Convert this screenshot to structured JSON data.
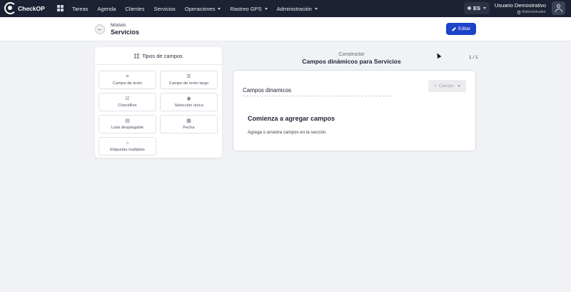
{
  "app": {
    "brand": "CheckOP"
  },
  "nav": {
    "items": [
      {
        "label": "Tareas",
        "dropdown": false
      },
      {
        "label": "Agenda",
        "dropdown": false
      },
      {
        "label": "Clientes",
        "dropdown": false
      },
      {
        "label": "Servicios",
        "dropdown": false
      },
      {
        "label": "Operaciones",
        "dropdown": true
      },
      {
        "label": "Rastreo GPS",
        "dropdown": true
      },
      {
        "label": "Administración",
        "dropdown": true
      }
    ],
    "language": "ES",
    "user": {
      "name": "Usuario Demostrativo",
      "role": "Administrador"
    }
  },
  "header": {
    "breadcrumb_small": "Módulo",
    "title": "Servicios",
    "edit_label": "Editar"
  },
  "field_types": {
    "title": "Tipos de campos",
    "items": [
      {
        "label": "Campo de texto",
        "icon": "text-lines-icon"
      },
      {
        "label": "Campo de texto largo",
        "icon": "long-text-icon"
      },
      {
        "label": "CheckBox",
        "icon": "checkbox-icon"
      },
      {
        "label": "Selección única",
        "icon": "radio-icon"
      },
      {
        "label": "Lista desplegable",
        "icon": "dropdown-list-icon"
      },
      {
        "label": "Fecha",
        "icon": "calendar-icon"
      },
      {
        "label": "Etiquetas multiples",
        "icon": "tags-icon"
      }
    ]
  },
  "constructor": {
    "label": "Constructor",
    "title": "Campos dinámicos para Servicios",
    "page_count": "1 / 1",
    "section_title": "Campos dinamicos",
    "add_field_label": "Campo",
    "empty_title": "Comienza a agregar campos",
    "empty_desc": "Agrega o arrastra campos en la sección."
  },
  "colors": {
    "nav_bg": "#1c2233",
    "primary": "#1d43c9",
    "page_bg": "#f1f2f5"
  }
}
